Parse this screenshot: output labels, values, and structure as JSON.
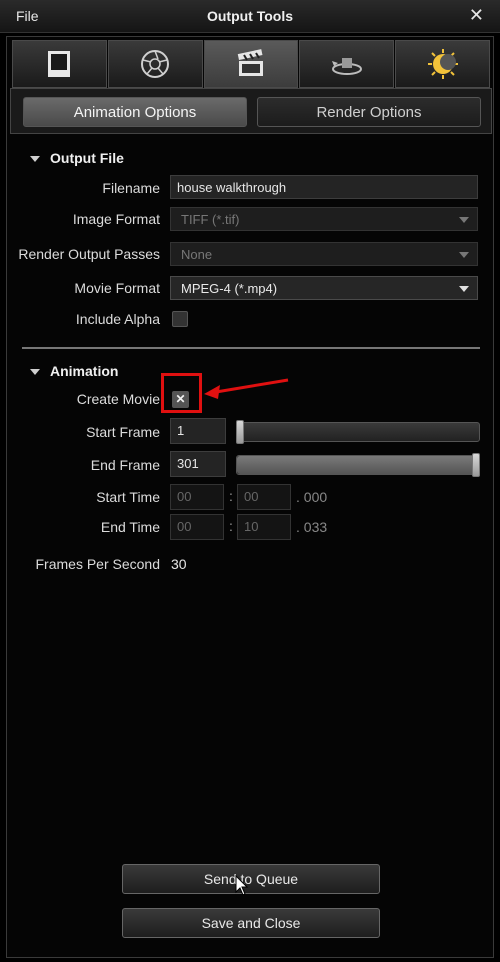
{
  "window": {
    "menu_label": "File",
    "title": "Output Tools",
    "close_glyph": "✕"
  },
  "tabs": [
    {
      "name": "tab-page",
      "icon": "page-icon"
    },
    {
      "name": "tab-aperture",
      "icon": "aperture-icon"
    },
    {
      "name": "tab-animation",
      "icon": "clapperboard-icon",
      "active": true
    },
    {
      "name": "tab-rotate",
      "icon": "rotate-icon"
    },
    {
      "name": "tab-sun",
      "icon": "sun-icon"
    }
  ],
  "subtabs": {
    "animation_options": "Animation Options",
    "render_options": "Render Options"
  },
  "output_file": {
    "heading": "Output File",
    "filename_label": "Filename",
    "filename_value": "house walkthrough",
    "image_format_label": "Image Format",
    "image_format_value": "TIFF (*.tif)",
    "render_passes_label": "Render Output Passes",
    "render_passes_value": "None",
    "movie_format_label": "Movie Format",
    "movie_format_value": "MPEG-4 (*.mp4)",
    "include_alpha_label": "Include Alpha"
  },
  "animation": {
    "heading": "Animation",
    "create_movie_label": "Create Movie",
    "create_movie_mark": "✕",
    "start_frame_label": "Start Frame",
    "start_frame_value": "1",
    "end_frame_label": "End Frame",
    "end_frame_value": "301",
    "start_time_label": "Start Time",
    "start_time_min": "00",
    "start_time_sec": "00",
    "start_time_ms": ". 000",
    "end_time_label": "End Time",
    "end_time_min": "00",
    "end_time_sec": "10",
    "end_time_ms": ". 033",
    "time_separator": ":",
    "fps_label": "Frames Per Second",
    "fps_value": "30"
  },
  "buttons": {
    "send_to_queue": "Send to Queue",
    "save_and_close": "Save and Close"
  },
  "colors": {
    "annotation": "#e01010",
    "background": "#000000"
  }
}
